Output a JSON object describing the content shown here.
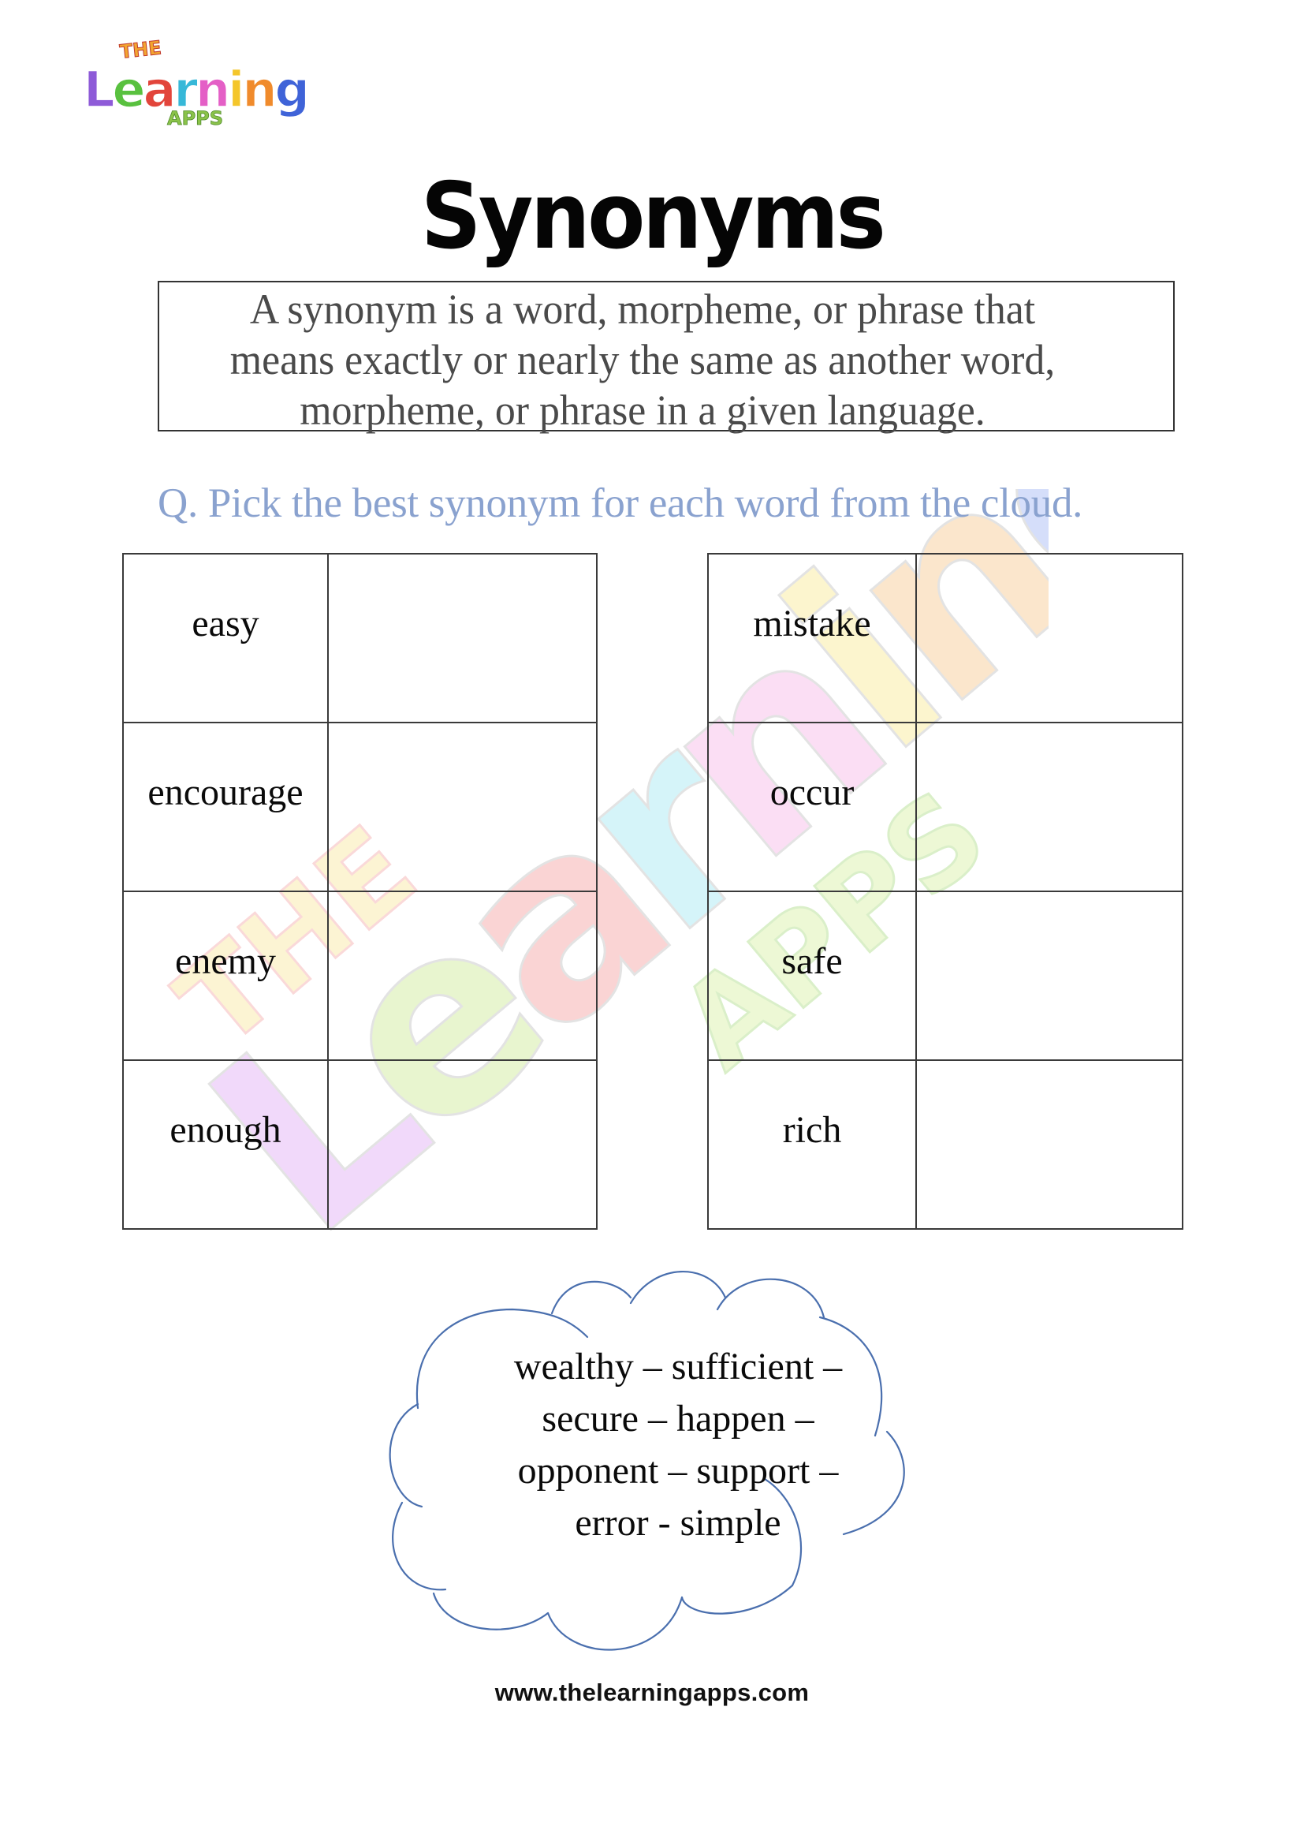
{
  "logo": {
    "top_word": "THE",
    "main_word": "Learning",
    "sub_word": "APPS",
    "icon": "the-learning-apps-logo"
  },
  "watermark": {
    "icon": "the-learning-apps-watermark",
    "top_word": "THE",
    "main_word": "Learning",
    "sub_word": "APPS"
  },
  "title": "Synonyms",
  "definition": {
    "lines": [
      "A synonym is a word, morpheme, or phrase that",
      "means exactly or nearly the same as another word,",
      "morpheme, or phrase in a given language."
    ]
  },
  "question": "Q.  Pick the best synonym for each word from the cloud.",
  "tables": {
    "left": {
      "rows": [
        {
          "word": "easy",
          "answer": ""
        },
        {
          "word": "encourage",
          "answer": ""
        },
        {
          "word": "enemy",
          "answer": ""
        },
        {
          "word": "enough",
          "answer": ""
        }
      ]
    },
    "right": {
      "rows": [
        {
          "word": "mistake",
          "answer": ""
        },
        {
          "word": "occur",
          "answer": ""
        },
        {
          "word": "safe",
          "answer": ""
        },
        {
          "word": "rich",
          "answer": ""
        }
      ]
    }
  },
  "cloud": {
    "icon": "cloud-shape",
    "lines": [
      "wealthy – sufficient –",
      "secure – happen –",
      "opponent – support –",
      "error - simple"
    ]
  },
  "footer": {
    "url": "www.thelearningapps.com"
  },
  "colors": {
    "question": "#8aa2cf",
    "cloud_stroke": "#4a6fae",
    "border": "#333333"
  }
}
